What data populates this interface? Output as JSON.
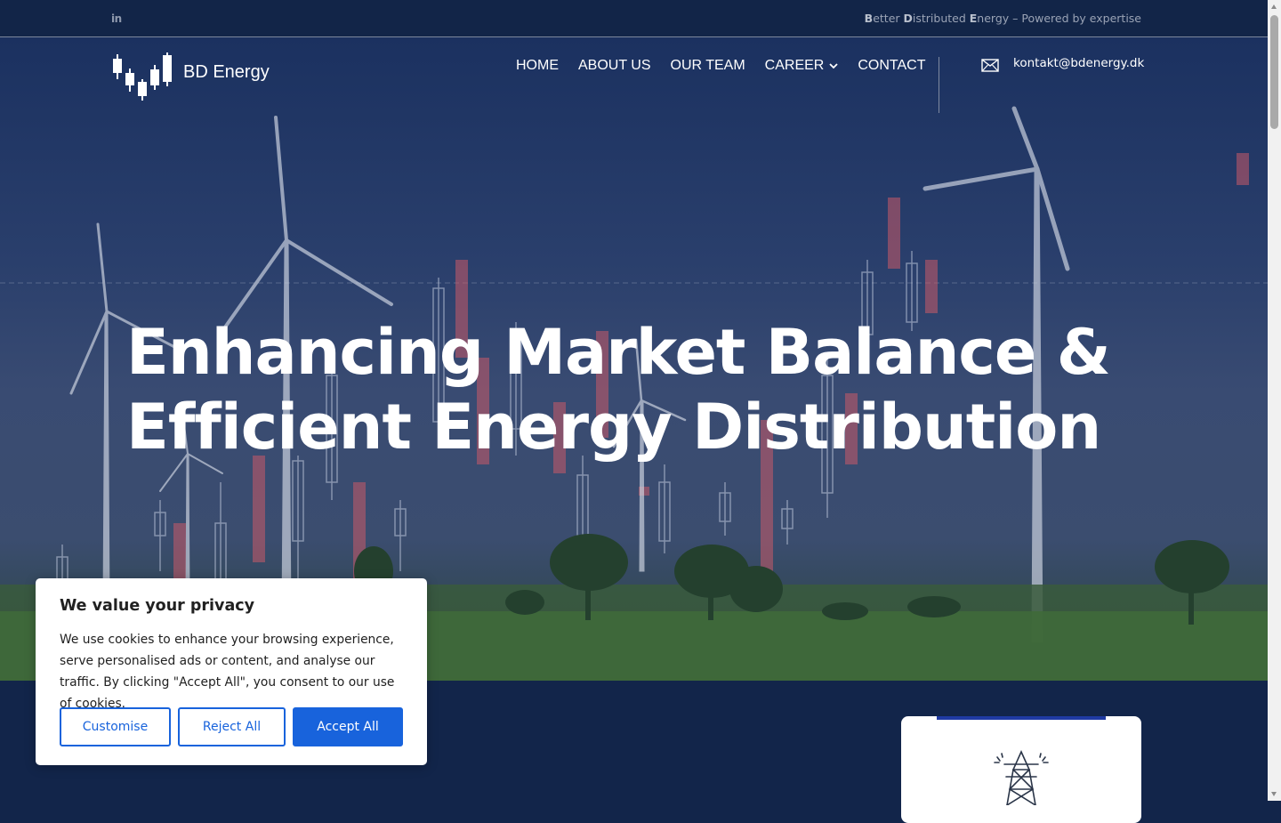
{
  "topbar": {
    "social_icon": "linkedin-icon",
    "linkedin_label": "in",
    "tagline": {
      "b1": "B",
      "r1": "etter ",
      "b2": "D",
      "r2": "istributed ",
      "b3": "E",
      "r3": "nergy – Powered by expertise"
    }
  },
  "header": {
    "logo_text": "BD Energy",
    "logo_icon": "candlestick-chart-icon",
    "nav": {
      "home": "HOME",
      "about": "ABOUT US",
      "team": "OUR TEAM",
      "career": "CAREER",
      "contact": "CONTACT"
    },
    "email_icon": "envelope-icon",
    "email": "kontakt@bdenergy.dk"
  },
  "hero": {
    "headline_line1": "Enhancing Market Balance &",
    "headline_line2": "Efficient Energy Distribution"
  },
  "card": {
    "icon": "power-tower-icon",
    "accent_color": "#1f3aa3"
  },
  "cookie": {
    "title": "We value your privacy",
    "text": "We use cookies to enhance your browsing experience, serve personalised ads or content, and analyse our traffic. By clicking \"Accept All\", you consent to our use of cookies.",
    "customise": "Customise",
    "reject": "Reject All",
    "accept": "Accept All",
    "accent_color": "#1863dc"
  },
  "colors": {
    "navy": "#12254a",
    "white": "#ffffff"
  }
}
